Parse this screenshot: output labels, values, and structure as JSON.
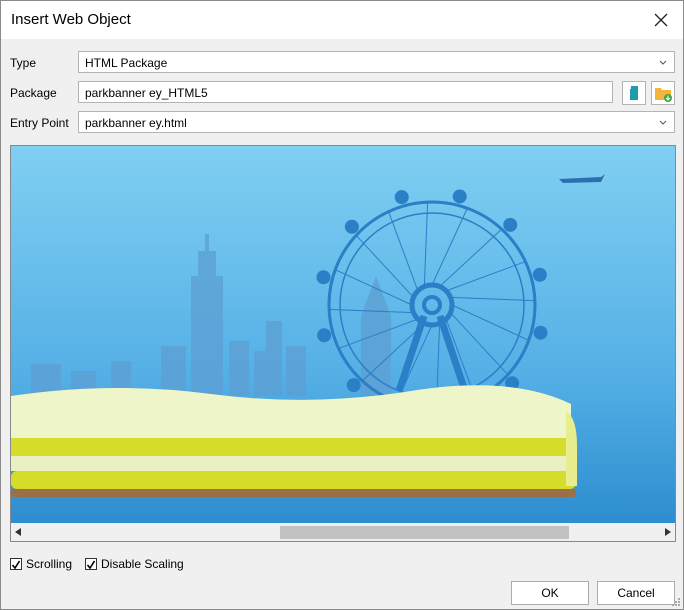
{
  "dialog": {
    "title": "Insert Web Object"
  },
  "form": {
    "type": {
      "label": "Type",
      "value": "HTML Package"
    },
    "package": {
      "label": "Package",
      "value": "parkbanner ey_HTML5"
    },
    "entry_point": {
      "label": "Entry Point",
      "value": "parkbanner ey.html"
    }
  },
  "options": {
    "scrolling": {
      "label": "Scrolling",
      "checked": true
    },
    "disable_scaling": {
      "label": "Disable Scaling",
      "checked": true
    }
  },
  "buttons": {
    "ok": "OK",
    "cancel": "Cancel"
  },
  "colors": {
    "sky_top": "#7fcdf0",
    "sky_bottom": "#2f8fd0",
    "wheel": "#2a7fc6",
    "grass_light": "#eef5c8",
    "grass_yellow": "#d6dc2a",
    "soil": "#9b7047",
    "new_icon": "#1e9cad",
    "folder_icon": "#f4b53f"
  }
}
